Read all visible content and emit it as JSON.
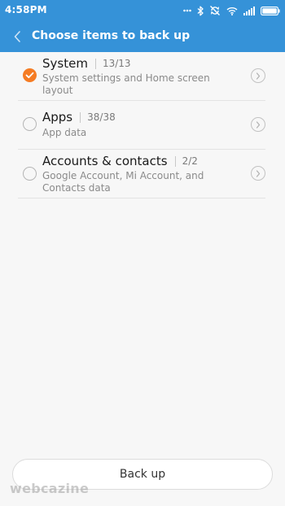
{
  "status_bar": {
    "time": "4:58PM",
    "icons": [
      "dots-icon",
      "bluetooth-icon",
      "sync-off-icon",
      "wifi-icon",
      "signal-icon",
      "battery-icon"
    ]
  },
  "header": {
    "title": "Choose items to back up",
    "background": "#3592d8"
  },
  "items": [
    {
      "title": "System",
      "count": "13/13",
      "description": "System settings and Home screen layout",
      "checked": true
    },
    {
      "title": "Apps",
      "count": "38/38",
      "description": "App data",
      "checked": false
    },
    {
      "title": "Accounts & contacts",
      "count": "2/2",
      "description": "Google Account, Mi Account, and Contacts data",
      "checked": false
    }
  ],
  "footer": {
    "backup_label": "Back up",
    "watermark": "webcazine"
  },
  "colors": {
    "accent": "#f57c24",
    "header": "#3592d8"
  }
}
